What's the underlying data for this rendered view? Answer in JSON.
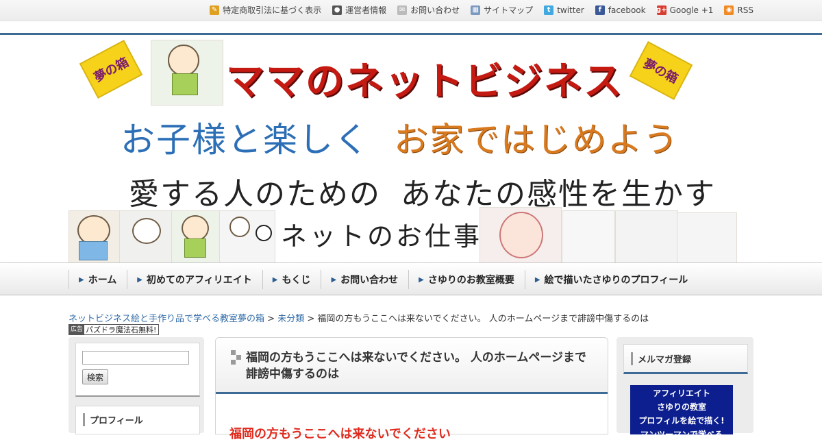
{
  "top_links": [
    {
      "label": "特定商取引法に基づく表示",
      "icon": "edit-icon",
      "color": "#e0a020"
    },
    {
      "label": "運営者情報",
      "icon": "person-icon",
      "color": "#555555"
    },
    {
      "label": "お問い合わせ",
      "icon": "mail-icon",
      "color": "#bbbbbb"
    },
    {
      "label": "サイトマップ",
      "icon": "sitemap-icon",
      "color": "#7c9ac0"
    },
    {
      "label": "twitter",
      "icon": "twitter-icon",
      "color": "#3fa9e0"
    },
    {
      "label": "facebook",
      "icon": "facebook-icon",
      "color": "#3b5998"
    },
    {
      "label": "Google +1",
      "icon": "google-plus-icon",
      "color": "#d73d32"
    },
    {
      "label": "RSS",
      "icon": "rss-icon",
      "color": "#f08a24"
    }
  ],
  "banner": {
    "badge_left": "夢の箱",
    "badge_right": "夢の箱",
    "title": "ママのネットビジネス",
    "sub_blue": "お子様と楽しく",
    "sub_orange": "お家ではじめよう",
    "line3a": "愛する人のための",
    "line3b": "あなたの感性を生かす",
    "line4": "ネットのお仕事"
  },
  "nav": [
    "ホーム",
    "初めてのアフィリエイト",
    "もくじ",
    "お問い合わせ",
    "さゆりのお教室概要",
    "絵で描いたさゆりのプロフィール"
  ],
  "breadcrumb": {
    "home": "ネットビジネス絵と手作り品で学べる教室夢の箱",
    "sep": ">",
    "category": "未分類",
    "current": "福岡の方もうここへは来ないでください。 人のホームページまで誹謗中傷するのは"
  },
  "ad": {
    "pr": "広告",
    "text": "パズドラ魔法石無料!"
  },
  "sidebar": {
    "search_placeholder": "",
    "search_button": "検索",
    "profile_title": "プロフィール"
  },
  "post": {
    "title": "福岡の方もうここへは来ないでください。 人のホームページまで誹謗中傷するのは",
    "lead": "福岡の方もうここへは来ないでください"
  },
  "right": {
    "mm_title": "メルマガ登録",
    "banner_lines": [
      "アフィリエイト",
      "さゆりの教室",
      "プロフィルを絵で描く!",
      "マンツーマンで学べる"
    ]
  }
}
